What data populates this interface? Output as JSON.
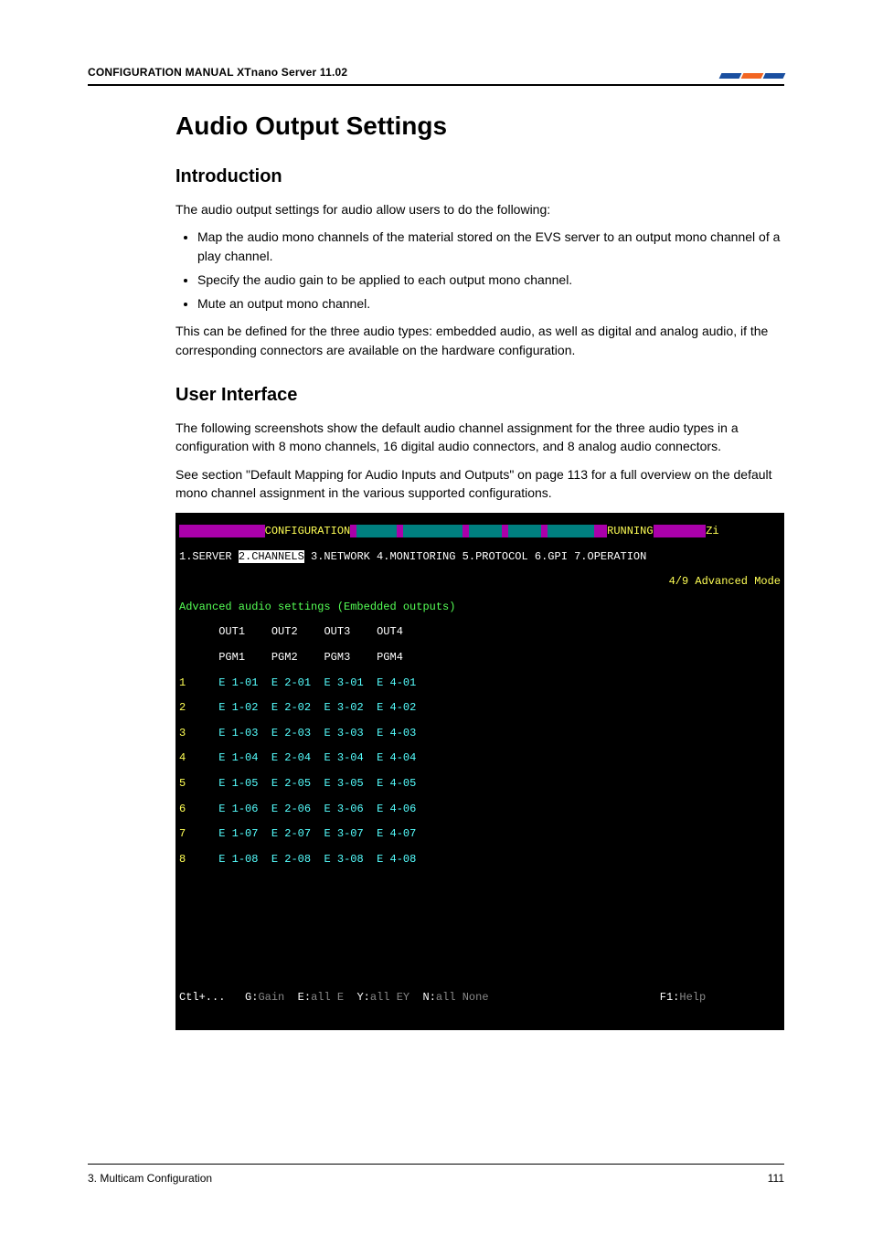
{
  "header": {
    "title": "CONFIGURATION MANUAL   XTnano Server 11.02"
  },
  "main": {
    "title": "Audio Output Settings",
    "intro": {
      "heading": "Introduction",
      "lead": "The audio output settings for audio allow users to do the following:",
      "items": [
        "Map the audio mono channels of the material stored on the EVS server to an output mono channel of a play channel.",
        "Specify the audio gain to be applied to each output mono channel.",
        "Mute an output mono channel."
      ],
      "note": "This can be defined for the three audio types: embedded audio, as well as digital and analog audio, if the corresponding connectors are available on the hardware configuration."
    },
    "ui": {
      "heading": "User Interface",
      "p1": "The following screenshots show the default audio channel assignment for the three audio types in a configuration with 8 mono channels, 16 digital audio connectors, and 8 analog audio connectors.",
      "p2": "See section \"Default Mapping for Audio Inputs and Outputs\" on page 113 for a full overview on the default mono channel assignment in the various supported configurations."
    }
  },
  "terminal": {
    "header": {
      "config": "CONFIGURATION",
      "blanks": [
        "      ",
        "         ",
        "     ",
        "     ",
        "       "
      ],
      "running": "RUNNING",
      "zi": "Zi"
    },
    "tabs": [
      "1.SERVER",
      "2.CHANNELS",
      "3.NETWORK",
      "4.MONITORING",
      "5.PROTOCOL",
      "6.GPI",
      "7.OPERATION"
    ],
    "mode": "4/9 Advanced Mode",
    "section": "Advanced audio settings (Embedded outputs)",
    "cols": [
      "OUT1",
      "OUT2",
      "OUT3",
      "OUT4"
    ],
    "pgms": [
      "PGM1",
      "PGM2",
      "PGM3",
      "PGM4"
    ],
    "rows": [
      {
        "n": "1",
        "c": [
          "E 1-01",
          "E 2-01",
          "E 3-01",
          "E 4-01"
        ]
      },
      {
        "n": "2",
        "c": [
          "E 1-02",
          "E 2-02",
          "E 3-02",
          "E 4-02"
        ]
      },
      {
        "n": "3",
        "c": [
          "E 1-03",
          "E 2-03",
          "E 3-03",
          "E 4-03"
        ]
      },
      {
        "n": "4",
        "c": [
          "E 1-04",
          "E 2-04",
          "E 3-04",
          "E 4-04"
        ]
      },
      {
        "n": "5",
        "c": [
          "E 1-05",
          "E 2-05",
          "E 3-05",
          "E 4-05"
        ]
      },
      {
        "n": "6",
        "c": [
          "E 1-06",
          "E 2-06",
          "E 3-06",
          "E 4-06"
        ]
      },
      {
        "n": "7",
        "c": [
          "E 1-07",
          "E 2-07",
          "E 3-07",
          "E 4-07"
        ]
      },
      {
        "n": "8",
        "c": [
          "E 1-08",
          "E 2-08",
          "E 3-08",
          "E 4-08"
        ]
      }
    ],
    "footer": {
      "ctl": "Ctl+...",
      "g": {
        "k": "G:",
        "v": "Gain"
      },
      "e": {
        "k": "E:",
        "v": "all E"
      },
      "y": {
        "k": "Y:",
        "v": "all EY"
      },
      "n": {
        "k": "N:",
        "v": "all None"
      },
      "f1": {
        "k": "F1:",
        "v": "Help"
      }
    }
  },
  "footer": {
    "section": "3. Multicam Configuration",
    "page": "111"
  }
}
